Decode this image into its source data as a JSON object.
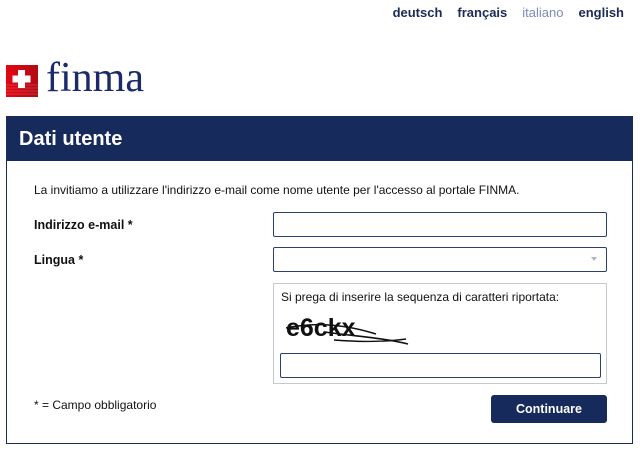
{
  "languages": [
    {
      "label": "deutsch",
      "active": false
    },
    {
      "label": "français",
      "active": false
    },
    {
      "label": "italiano",
      "active": true
    },
    {
      "label": "english",
      "active": false
    }
  ],
  "brand": {
    "name": "finma",
    "color": "#1b2a68",
    "flag_color": "#e30613"
  },
  "panel": {
    "title": "Dati utente",
    "intro": "La invitiamo a utilizzare l'indirizzo e-mail come nome utente per l'accesso al portale FINMA.",
    "email_label": "Indirizzo e-mail *",
    "email_value": "",
    "language_label": "Lingua *",
    "language_value": "",
    "captcha_prompt": "Si prega di inserire la sequenza di caratteri riportata:",
    "captcha_text": "e6ckx",
    "captcha_value": "",
    "required_note": "*  = Campo obbligatorio",
    "submit_label": "Continuare"
  },
  "colors": {
    "header_bg": "#162a5c",
    "button_bg": "#162a5c",
    "field_border": "#2b3f73"
  }
}
